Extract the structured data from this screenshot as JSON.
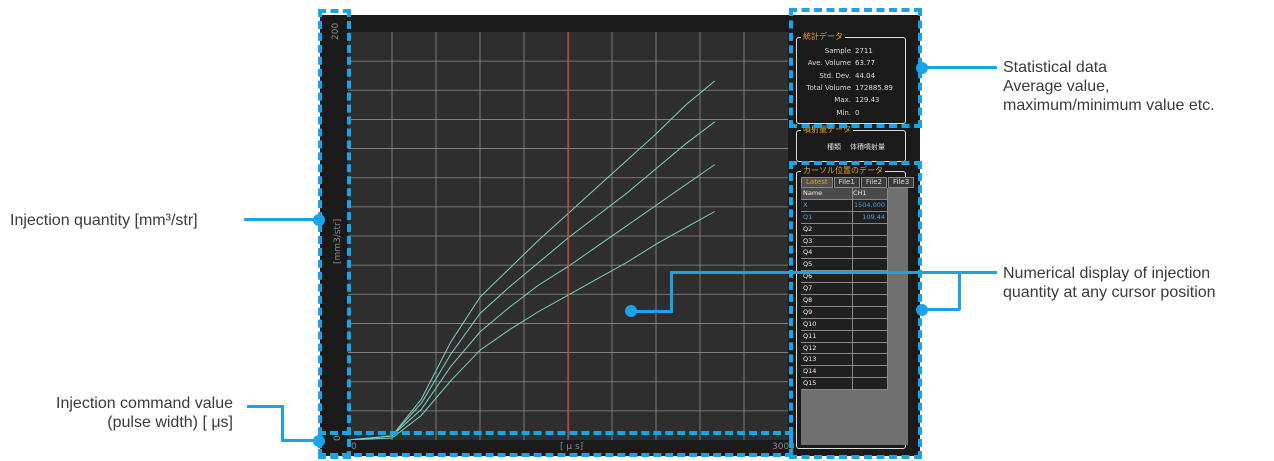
{
  "colors": {
    "accent": "#1aa3e8",
    "app_bg": "#1a1a1a",
    "plot_bg": "#2e2e2e",
    "grid": "#8c8c8c",
    "curve": "#7fd1c0",
    "cursor": "#e23030",
    "panel_title": "#e8a030"
  },
  "annotations": {
    "injection_quantity": "Injection quantity [mm³/str]",
    "command_value_line1": "Injection command value",
    "command_value_line2": "(pulse width) [ μs]",
    "statistical_line1": "Statistical data",
    "statistical_line2": "Average value,",
    "statistical_line3": "maximum/minimum value etc.",
    "numerical_line1": "Numerical display of injection",
    "numerical_line2": "quantity at any cursor position"
  },
  "chart": {
    "y_axis_label": "[mm3/str]",
    "x_axis_label": "[ μ s]",
    "y_tick_top": "200",
    "y_tick_bottom": "0",
    "x_tick_left": "0",
    "x_tick_right": "3000"
  },
  "chart_data": {
    "type": "line",
    "xlabel": "[ μ s]",
    "ylabel": "[mm3/str]",
    "xlim": [
      0,
      3000
    ],
    "ylim": [
      0,
      200
    ],
    "cursor_x": 1504,
    "series": [
      {
        "x": [
          0,
          300,
          500,
          700,
          900,
          1100,
          1300,
          1500,
          1700,
          1900,
          2100,
          2300,
          2500
        ],
        "values": [
          0,
          2,
          20,
          48,
          70,
          84,
          98,
          111,
          124,
          137,
          150,
          164,
          176
        ]
      },
      {
        "x": [
          0,
          300,
          500,
          700,
          900,
          1100,
          1300,
          1500,
          1700,
          1900,
          2100,
          2300,
          2500
        ],
        "values": [
          0,
          2,
          18,
          42,
          62,
          75,
          87,
          99,
          110,
          121,
          133,
          145,
          156
        ]
      },
      {
        "x": [
          0,
          300,
          500,
          700,
          900,
          1100,
          1300,
          1500,
          1700,
          1900,
          2100,
          2300,
          2500
        ],
        "values": [
          0,
          2,
          15,
          36,
          53,
          65,
          76,
          85,
          95,
          105,
          115,
          125,
          135
        ]
      },
      {
        "x": [
          0,
          300,
          500,
          700,
          900,
          1100,
          1300,
          1500,
          1700,
          1900,
          2100,
          2300,
          2500
        ],
        "values": [
          0,
          1,
          12,
          29,
          44,
          54,
          63,
          71,
          79,
          87,
          96,
          104,
          112
        ]
      }
    ]
  },
  "stats_panel": {
    "title": "統計データ",
    "rows": [
      {
        "label": "Sample",
        "value": "2711"
      },
      {
        "label": "Ave. Volume",
        "value": "63.77"
      },
      {
        "label": "Std. Dev.",
        "value": "44.04"
      },
      {
        "label": "Total Volume",
        "value": "172885.89"
      },
      {
        "label": "Max.",
        "value": "129.43"
      },
      {
        "label": "Min.",
        "value": "0"
      }
    ]
  },
  "injection_panel": {
    "title": "噴射量データ",
    "type_label": "種類",
    "type_value": "体積噴射量"
  },
  "cursor_panel": {
    "title": "カーソル位置のデータ",
    "tabs": [
      "Latest",
      "File1",
      "File2",
      "File3"
    ],
    "columns": [
      "Name",
      "CH1"
    ],
    "rows": [
      {
        "name": "X",
        "value": "1504.000"
      },
      {
        "name": "Q1",
        "value": "109.44"
      },
      {
        "name": "Q2",
        "value": ""
      },
      {
        "name": "Q3",
        "value": ""
      },
      {
        "name": "Q4",
        "value": ""
      },
      {
        "name": "Q5",
        "value": ""
      },
      {
        "name": "Q6",
        "value": ""
      },
      {
        "name": "Q7",
        "value": ""
      },
      {
        "name": "Q8",
        "value": ""
      },
      {
        "name": "Q9",
        "value": ""
      },
      {
        "name": "Q10",
        "value": ""
      },
      {
        "name": "Q11",
        "value": ""
      },
      {
        "name": "Q12",
        "value": ""
      },
      {
        "name": "Q13",
        "value": ""
      },
      {
        "name": "Q14",
        "value": ""
      },
      {
        "name": "Q15",
        "value": ""
      }
    ]
  }
}
